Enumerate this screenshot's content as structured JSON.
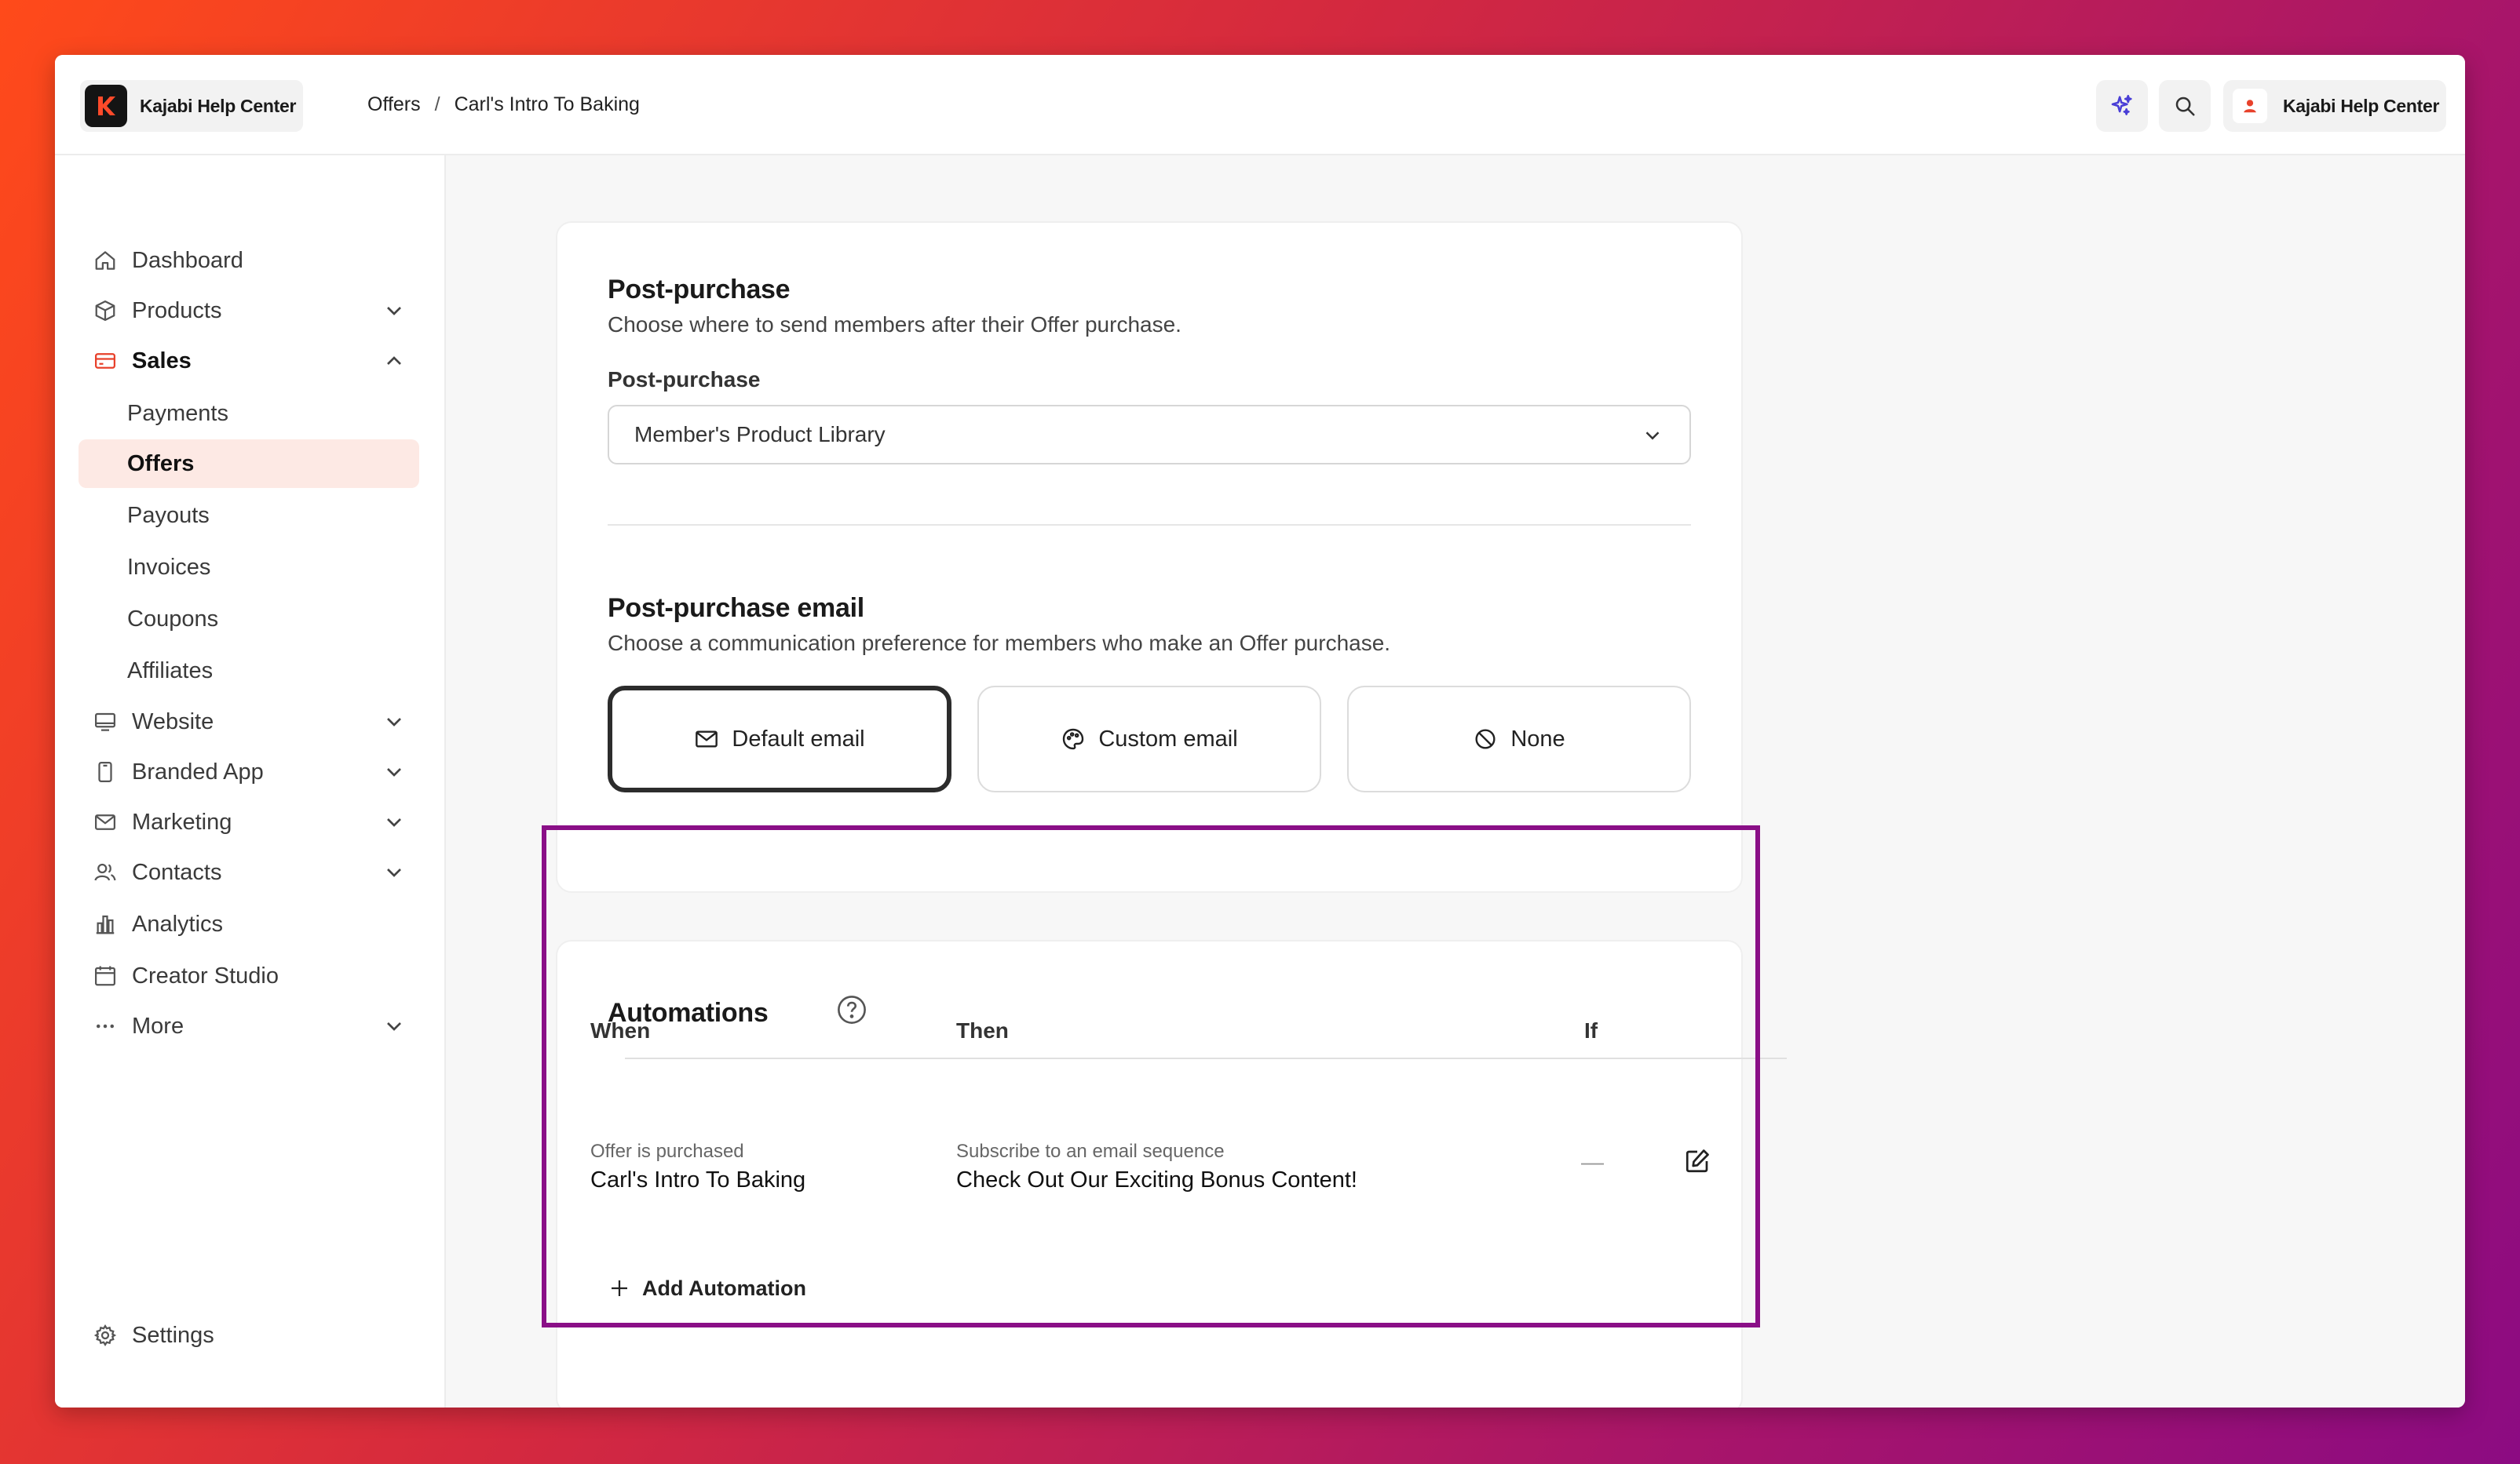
{
  "app": {
    "name": "Kajabi Help Center"
  },
  "breadcrumb": {
    "parent": "Offers",
    "separator": "/",
    "current": "Carl's Intro To Baking"
  },
  "account": {
    "name": "Kajabi Help Center"
  },
  "colors": {
    "accent": "#e8412b",
    "highlight": "#8a0f87",
    "active_bg": "#fde9e4"
  },
  "sidebar": {
    "items": [
      {
        "label": "Dashboard",
        "icon": "home-icon"
      },
      {
        "label": "Products",
        "icon": "box-icon"
      },
      {
        "label": "Sales",
        "icon": "credit-card-icon"
      },
      {
        "label": "Payments"
      },
      {
        "label": "Offers"
      },
      {
        "label": "Payouts"
      },
      {
        "label": "Invoices"
      },
      {
        "label": "Coupons"
      },
      {
        "label": "Affiliates"
      },
      {
        "label": "Website",
        "icon": "monitor-icon"
      },
      {
        "label": "Branded App",
        "icon": "phone-icon"
      },
      {
        "label": "Marketing",
        "icon": "mail-icon"
      },
      {
        "label": "Contacts",
        "icon": "people-icon"
      },
      {
        "label": "Analytics",
        "icon": "chart-icon"
      },
      {
        "label": "Creator Studio",
        "icon": "calendar-icon"
      },
      {
        "label": "More",
        "icon": "dots-icon"
      }
    ],
    "settings": "Settings"
  },
  "post_purchase": {
    "title": "Post-purchase",
    "description": "Choose where to send members after their Offer purchase.",
    "field_label": "Post-purchase",
    "selected": "Member's Product Library"
  },
  "post_purchase_email": {
    "title": "Post-purchase email",
    "description": "Choose a communication preference for members who make an Offer purchase.",
    "options": [
      "Default email",
      "Custom email",
      "None"
    ],
    "selected": "Default email"
  },
  "automations": {
    "title": "Automations",
    "columns": [
      "When",
      "Then",
      "If"
    ],
    "rows": [
      {
        "when_caption": "Offer is purchased",
        "when_value": "Carl's Intro To Baking",
        "then_caption": "Subscribe to an email sequence",
        "then_value": "Check Out Our Exciting Bonus Content!",
        "if_value": "—"
      }
    ],
    "add_label": "Add Automation"
  }
}
